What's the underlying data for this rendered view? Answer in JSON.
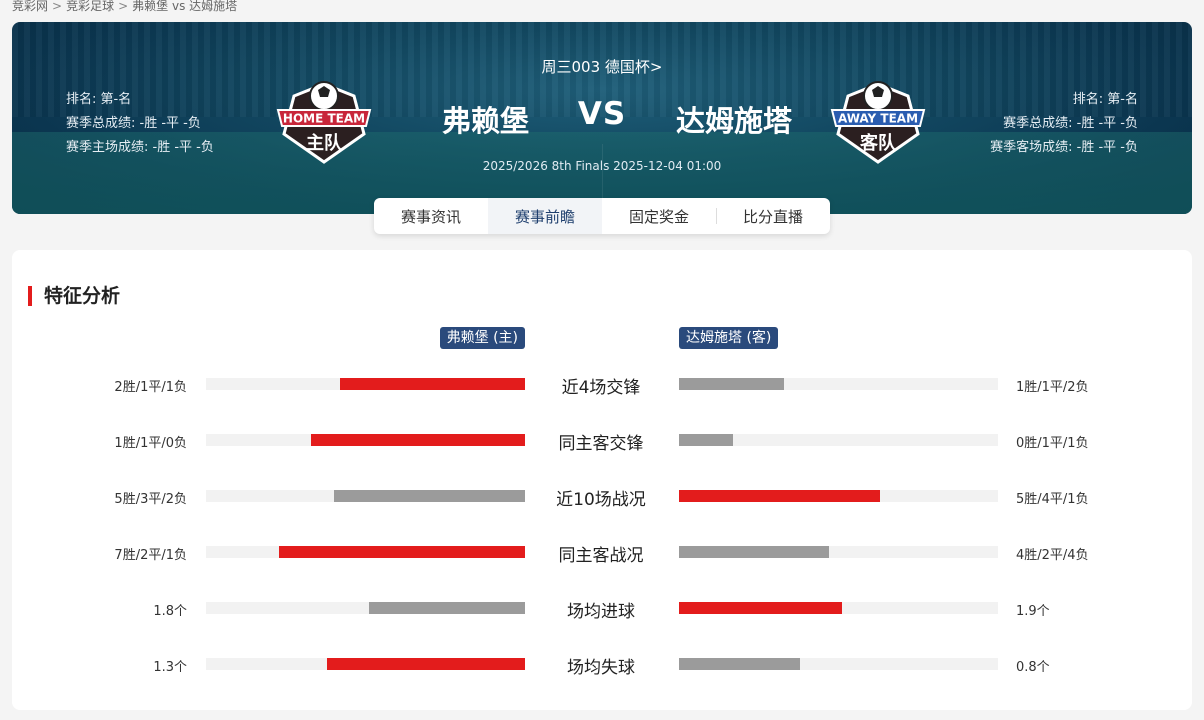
{
  "breadcrumb": [
    "竞彩网",
    "竞彩足球",
    "弗赖堡 vs 达姆施塔"
  ],
  "header": {
    "league": "周三003 德国杯>",
    "vs": "VS",
    "time": "2025/2026 8th Finals 2025-12-04 01:00",
    "home": {
      "name": "弗赖堡",
      "logo_top": "HOME TEAM",
      "logo_bottom": "主队",
      "rank": "排名: 第-名",
      "season": "赛季总成绩: -胜 -平 -负",
      "venue": "赛季主场成绩: -胜 -平 -负"
    },
    "away": {
      "name": "达姆施塔",
      "logo_top": "AWAY TEAM",
      "logo_bottom": "客队",
      "rank": "排名: 第-名",
      "season": "赛季总成绩: -胜 -平 -负",
      "venue": "赛季客场成绩: -胜 -平 -负"
    }
  },
  "tabs": [
    {
      "label": "赛事资讯",
      "active": false
    },
    {
      "label": "赛事前瞻",
      "active": true
    },
    {
      "label": "固定奖金",
      "active": false
    },
    {
      "label": "比分直播",
      "active": false
    }
  ],
  "analysis": {
    "title": "特征分析",
    "home_tag": "弗赖堡 (主)",
    "away_tag": "达姆施塔 (客)",
    "rows": [
      {
        "label": "近4场交锋",
        "home": "2胜/1平/1负",
        "away": "1胜/1平/2负",
        "home_pct": 58,
        "away_pct": 33,
        "home_color": "red",
        "away_color": "gray"
      },
      {
        "label": "同主客交锋",
        "home": "1胜/1平/0负",
        "away": "0胜/1平/1负",
        "home_pct": 67,
        "away_pct": 17,
        "home_color": "red",
        "away_color": "gray"
      },
      {
        "label": "近10场战况",
        "home": "5胜/3平/2负",
        "away": "5胜/4平/1负",
        "home_pct": 60,
        "away_pct": 63,
        "home_color": "gray",
        "away_color": "red"
      },
      {
        "label": "同主客战况",
        "home": "7胜/2平/1负",
        "away": "4胜/2平/4负",
        "home_pct": 77,
        "away_pct": 47,
        "home_color": "red",
        "away_color": "gray"
      },
      {
        "label": "场均进球",
        "home": "1.8个",
        "away": "1.9个",
        "home_pct": 49,
        "away_pct": 51,
        "home_color": "gray",
        "away_color": "red"
      },
      {
        "label": "场均失球",
        "home": "1.3个",
        "away": "0.8个",
        "home_pct": 62,
        "away_pct": 38,
        "home_color": "red",
        "away_color": "gray"
      }
    ]
  },
  "colors": {
    "accent_red": "#e31c1c",
    "bar_gray": "#9b9b9b",
    "team_tag_blue": "#2a4a7c"
  }
}
